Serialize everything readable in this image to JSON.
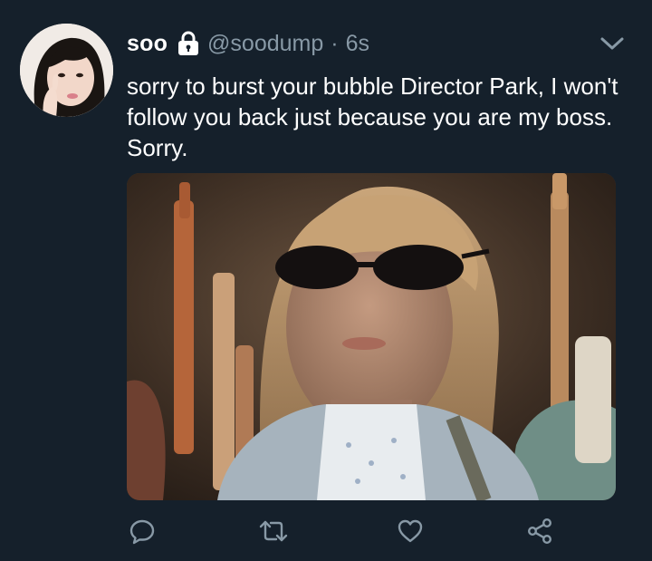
{
  "tweet": {
    "display_name": "soo",
    "handle": "@soodump",
    "separator": "·",
    "timestamp": "6s",
    "protected_icon": "lock-icon",
    "menu_icon": "chevron-down-icon",
    "text": "sorry to burst your bubble Director Park, I won't follow you back just because you are my boss. Sorry.",
    "media_description_icon": "photo",
    "actions": [
      {
        "name": "reply",
        "icon": "comment-icon"
      },
      {
        "name": "retweet",
        "icon": "retweet-icon"
      },
      {
        "name": "like",
        "icon": "heart-icon"
      },
      {
        "name": "share",
        "icon": "share-icon"
      }
    ]
  },
  "colors": {
    "background": "#15202b",
    "primary_text": "#ffffff",
    "secondary_text": "#8899a6"
  }
}
